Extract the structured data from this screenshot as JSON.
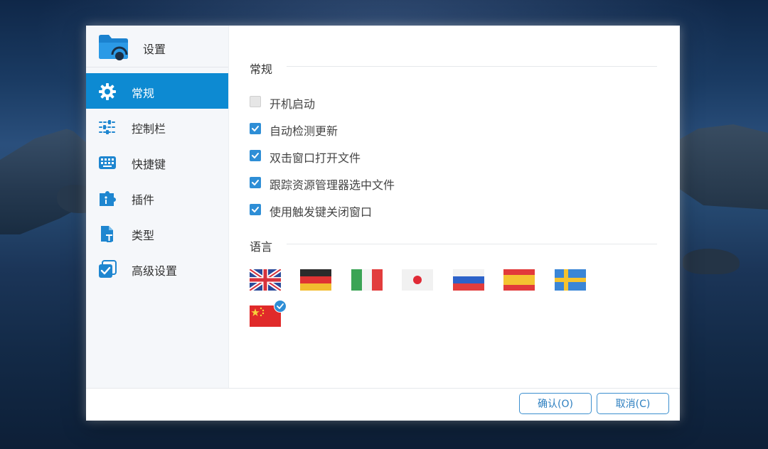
{
  "window": {
    "title": "设置"
  },
  "sidebar": {
    "items": [
      {
        "label": "常规",
        "icon": "gear-icon",
        "active": true
      },
      {
        "label": "控制栏",
        "icon": "sliders-icon",
        "active": false
      },
      {
        "label": "快捷键",
        "icon": "keyboard-icon",
        "active": false
      },
      {
        "label": "插件",
        "icon": "plugin-icon",
        "active": false
      },
      {
        "label": "类型",
        "icon": "file-type-icon",
        "active": false
      },
      {
        "label": "高级设置",
        "icon": "advanced-settings-icon",
        "active": false
      }
    ]
  },
  "general": {
    "title": "常规",
    "options": [
      {
        "label": "开机启动",
        "checked": false
      },
      {
        "label": "自动检测更新",
        "checked": true
      },
      {
        "label": "双击窗口打开文件",
        "checked": true
      },
      {
        "label": "跟踪资源管理器选中文件",
        "checked": true
      },
      {
        "label": "使用触发键关闭窗口",
        "checked": true
      }
    ]
  },
  "language": {
    "title": "语言",
    "flags": [
      "uk-flag",
      "germany-flag",
      "italy-flag",
      "japan-flag",
      "russia-flag",
      "spain-flag",
      "sweden-flag",
      "china-flag"
    ],
    "selected": "china-flag"
  },
  "footer": {
    "ok_label": "确认(O)",
    "cancel_label": "取消(C)"
  },
  "colors": {
    "accent": "#0d8ad2",
    "checkbox": "#2e8ed6",
    "button_border": "#3c8fcf"
  }
}
